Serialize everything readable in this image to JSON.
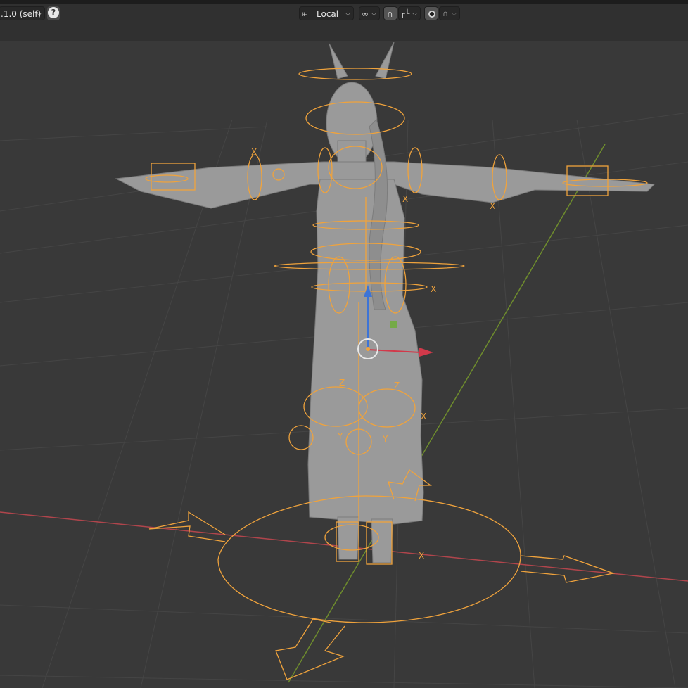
{
  "header": {
    "version_label": ".1.0 (self)",
    "help_label": "?",
    "pivot_label": "Local"
  },
  "viewport": {
    "gizmo_axis_labels": [
      "X",
      "X",
      "X",
      "X",
      "X",
      "X",
      "Y",
      "Y",
      "Z",
      "Z"
    ]
  },
  "colors": {
    "bone_orange": "#f0a33c",
    "grid_x_axis": "#b0454c",
    "grid_y_axis": "#6e8c2d",
    "viewport_bg": "#393939",
    "header_bg": "#303030",
    "mesh": "#9a9a9a"
  }
}
